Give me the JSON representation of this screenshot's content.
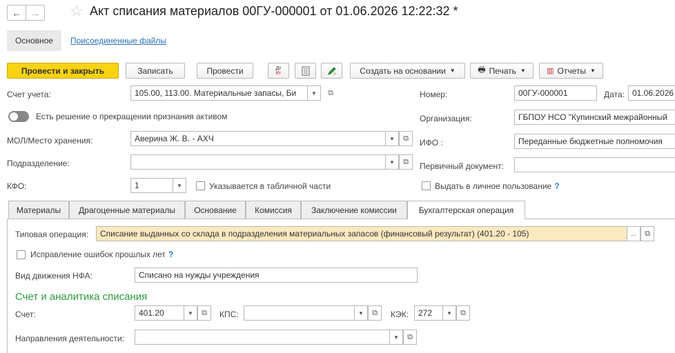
{
  "header": {
    "back_icon": "arrow-left-icon",
    "forward_icon": "arrow-right-icon",
    "favorite_icon": "star-icon",
    "title": "Акт списания материалов 00ГУ-000001 от 01.06.2026 12:22:32 *"
  },
  "nav_tabs": {
    "main": "Основное",
    "files": "Присоединенные файлы"
  },
  "toolbar": {
    "post_close": "Провести и закрыть",
    "save": "Записать",
    "post": "Провести",
    "dt_kt": "Дт Кт",
    "create_based": "Создать на основании",
    "print": "Печать",
    "reports": "Отчеты"
  },
  "form": {
    "account_label": "Счет учета:",
    "account_value": "105.00, 113.00. Материальные запасы, Би",
    "number_label": "Номер:",
    "number_value": "00ГУ-000001",
    "date_label": "Дата:",
    "date_value": "01.06.2026",
    "derecognition_toggle": "Есть решение о прекращении признания активом",
    "org_label": "Организация:",
    "org_value": "ГБПОУ НСО \"Купинский межрайонный",
    "mol_label": "МОЛ/Место хранения:",
    "mol_value": "Аверина Ж. В. - АХЧ",
    "ifo_label": "ИФО :",
    "ifo_value": "Переданные бюджетные полномочия",
    "division_label": "Подразделение:",
    "division_value": "",
    "primary_doc_label": "Первичный документ:",
    "primary_doc_value": "",
    "kfo_label": "КФО:",
    "kfo_value": "1",
    "tabular_check": "Указывается в табличной части",
    "personal_use_check": "Выдать в личное пользование",
    "help_mark": "?"
  },
  "tabs": [
    "Материалы",
    "Драгоценные материалы",
    "Основание",
    "Комиссия",
    "Заключение комиссии",
    "Бухгалтерская операция"
  ],
  "operation": {
    "typical_label": "Типовая операция:",
    "typical_value": "Списание выданных со склада в подразделения материальных запасов (финансовый результат) (401.20 - 105)",
    "fix_errors_check": "Исправление ошибок прошлых лет",
    "nfa_label": "Вид движения НФА:",
    "nfa_value": "Списано на нужды учреждения",
    "section_title": "Счет и аналитика списания",
    "account_label": "Счет:",
    "account_value": "401.20",
    "kps_label": "КПС:",
    "kps_value": "",
    "kek_label": "КЭК:",
    "kek_value": "272",
    "direction_label": "Направления деятельности:",
    "direction_value": ""
  },
  "glyphs": {
    "dd": "▼",
    "open": "⧉",
    "more": "..."
  },
  "colors": {
    "primary_button": "#f8d30f",
    "section_title": "#2a9a3a",
    "highlight_field": "#fde9c0"
  }
}
